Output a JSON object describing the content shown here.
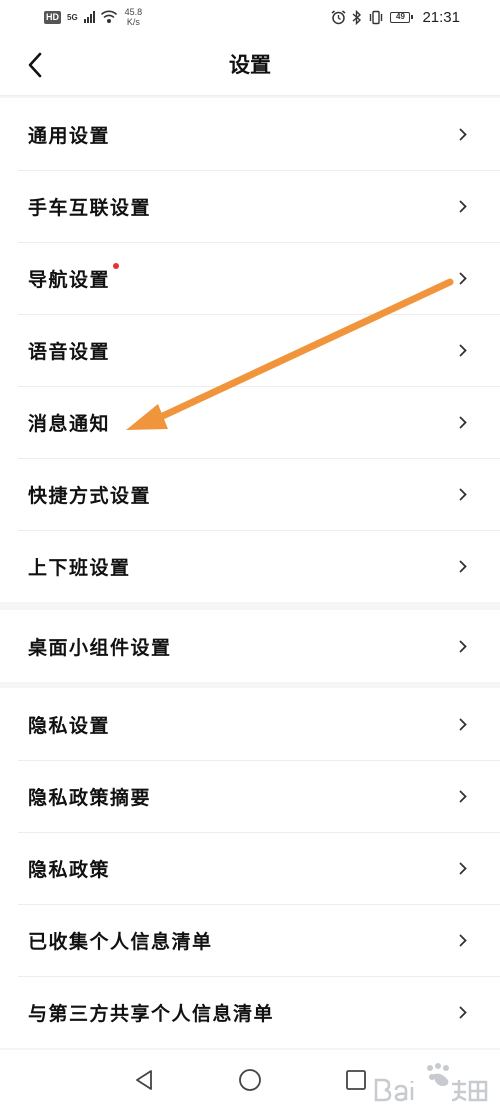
{
  "status_bar": {
    "hd": "HD",
    "network": "5G",
    "speed_value": "45.8",
    "speed_unit": "K/s",
    "battery": "49",
    "time": "21:31",
    "icons": [
      "alarm-icon",
      "bluetooth-icon",
      "vibrate-icon",
      "battery-icon",
      "signal-icon",
      "wifi-icon"
    ]
  },
  "header": {
    "title": "设置",
    "back_icon": "chevron-left-icon"
  },
  "groups": [
    {
      "items": [
        {
          "label": "通用设置",
          "badge": false
        },
        {
          "label": "手车互联设置",
          "badge": false
        },
        {
          "label": "导航设置",
          "badge": true
        },
        {
          "label": "语音设置",
          "badge": false
        },
        {
          "label": "消息通知",
          "badge": false
        },
        {
          "label": "快捷方式设置",
          "badge": false
        },
        {
          "label": "上下班设置",
          "badge": false
        }
      ]
    },
    {
      "items": [
        {
          "label": "桌面小组件设置",
          "badge": false
        }
      ]
    },
    {
      "items": [
        {
          "label": "隐私设置",
          "badge": false
        },
        {
          "label": "隐私政策摘要",
          "badge": false
        },
        {
          "label": "隐私政策",
          "badge": false
        },
        {
          "label": "已收集个人信息清单",
          "badge": false
        },
        {
          "label": "与第三方共享个人信息清单",
          "badge": false
        }
      ]
    }
  ],
  "navigation": {
    "buttons": [
      "back-triangle-icon",
      "home-circle-icon",
      "recents-square-icon"
    ]
  },
  "colors": {
    "annotation_arrow": "#f0953c",
    "badge": "#e3342f",
    "background": "#f4f5f7"
  }
}
